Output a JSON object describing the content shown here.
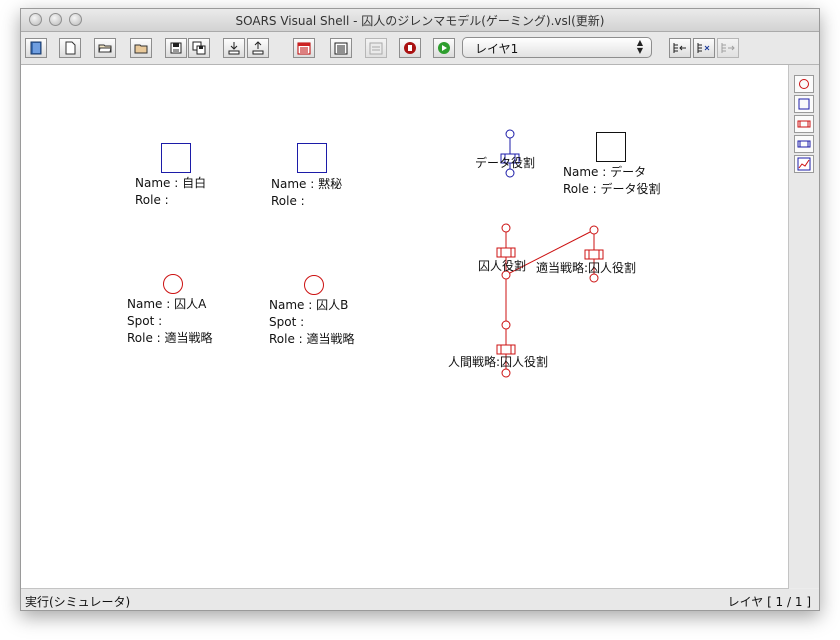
{
  "window": {
    "title": "SOARS Visual Shell - 囚人のジレンマモデル(ゲーミング).vsl(更新)"
  },
  "toolbar": {
    "layer_select": {
      "value": "レイヤ1"
    },
    "buttons": [
      "open-book-icon",
      "new-document-icon",
      "open-folder-icon",
      "folder-icon",
      "save-icon",
      "save-all-icon",
      "import-icon",
      "export-icon",
      "calendar-red-icon",
      "list-icon",
      "disabled-calendar-icon",
      "stop-icon",
      "play-icon",
      "layer-add-icon",
      "layer-remove-icon",
      "layer-forward-icon"
    ]
  },
  "palette": {
    "items": [
      "spot-tool-icon",
      "agent-tool-icon",
      "role-red-tool-icon",
      "role-blue-tool-icon",
      "chart-tool-icon"
    ]
  },
  "canvas": {
    "agents": [
      {
        "name_line": "Name : 自白",
        "role_line": "Role :"
      },
      {
        "name_line": "Name : 黙秘",
        "role_line": "Role :"
      },
      {
        "name_line": "Name : データ",
        "role_line": "Role : データ役割"
      }
    ],
    "spots": [
      {
        "name_line": "Name : 囚人A",
        "spot_line": "Spot :",
        "role_line": "Role : 適当戦略"
      },
      {
        "name_line": "Name : 囚人B",
        "spot_line": "Spot :",
        "role_line": "Role : 適当戦略"
      }
    ],
    "roles": {
      "data_role": "データ役割",
      "prisoner_role": "囚人役割",
      "tekito_role": "適当戦略:囚人役割",
      "human_role": "人間戦略:囚人役割"
    }
  },
  "colors": {
    "agent_blue": "#1c1ca8",
    "role_red": "#cc1111",
    "play_green": "#2e9e2e",
    "stop_red": "#aa1111"
  },
  "statusbar": {
    "mode": "実行(シミュレータ)",
    "layer_indicator": "レイヤ [ 1 / 1 ]"
  }
}
